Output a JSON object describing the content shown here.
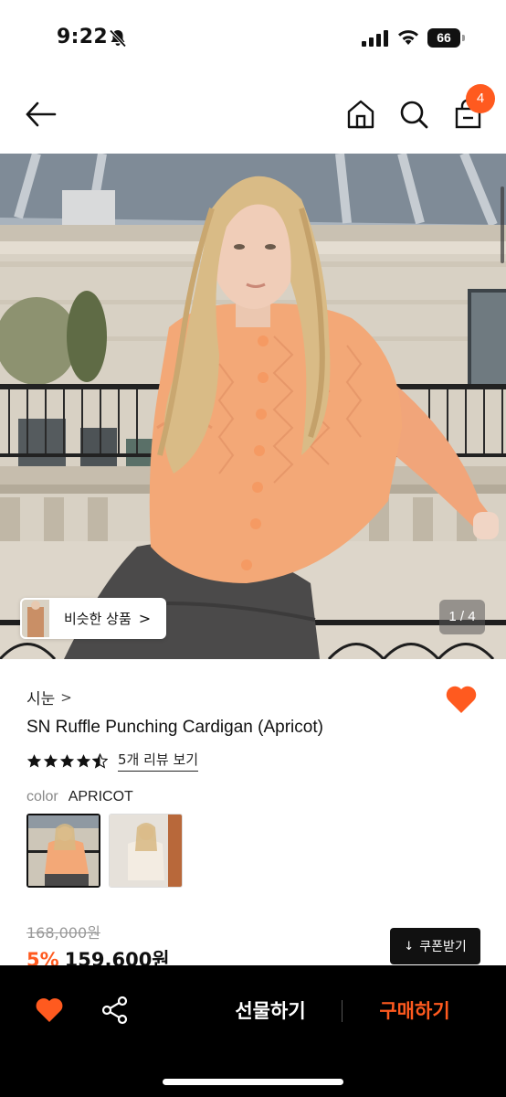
{
  "status_bar": {
    "time": "9:22",
    "battery": "66"
  },
  "header": {
    "cart_count": "4",
    "icons": [
      "back-arrow-icon",
      "home-icon",
      "search-icon",
      "shopping-bag-icon"
    ]
  },
  "gallery": {
    "similar_button_label": "비슷한 상품",
    "similar_chevron": ">",
    "page_indicator": "1 / 4"
  },
  "product": {
    "brand": "시눈",
    "brand_chevron": ">",
    "title": "SN Ruffle Punching Cardigan (Apricot)",
    "rating": 4.5,
    "review_link": "5개 리뷰 보기",
    "color_label": "color",
    "color_value": "APRICOT",
    "original_price": "168,000원",
    "discount": "5%",
    "final_price": "159,600원",
    "coupon_button": "쿠폰받기",
    "coupon_icon": "↓",
    "wishlisted": true
  },
  "bottom_bar": {
    "gift_button": "선물하기",
    "buy_button": "구매하기",
    "icons": [
      "heart-icon",
      "share-icon"
    ]
  },
  "colors": {
    "accent": "#ff5a1f",
    "bottom_bar": "#000000",
    "apricot": "#f3a877"
  }
}
